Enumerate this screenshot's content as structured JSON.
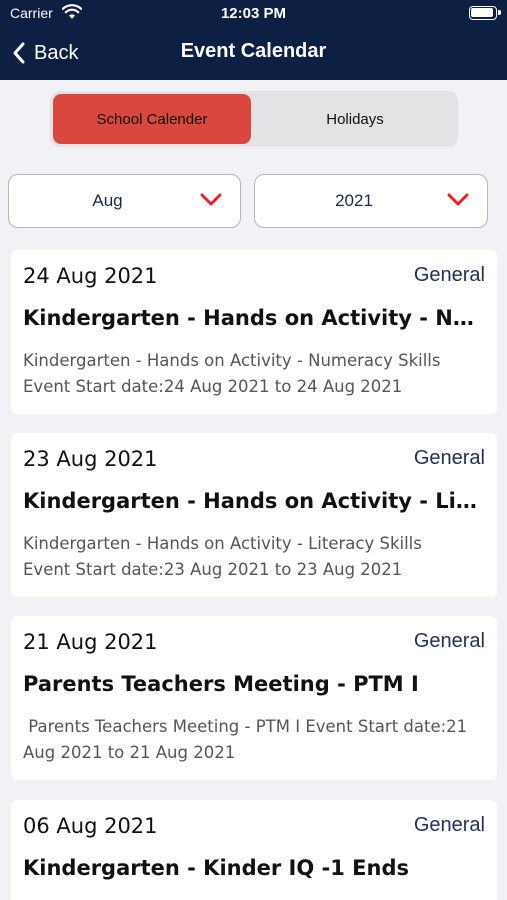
{
  "status_bar": {
    "carrier": "Carrier",
    "time": "12:03 PM"
  },
  "nav": {
    "back_label": "Back",
    "title": "Event Calendar"
  },
  "segments": {
    "active": "School Calender",
    "inactive": "Holidays"
  },
  "filters": {
    "month": "Aug",
    "year": "2021"
  },
  "colors": {
    "nav_bg": "#0e1f44",
    "accent": "#d9473e",
    "category": "#1f3156"
  },
  "events": [
    {
      "date": "24 Aug 2021",
      "category": "General",
      "title": "Kindergarten - Hands on Activity - Nume...",
      "description": "Kindergarten - Hands on Activity - Numeracy Skills\nEvent Start date:24 Aug 2021 to 24 Aug 2021"
    },
    {
      "date": "23 Aug 2021",
      "category": "General",
      "title": "Kindergarten - Hands on Activity - Litera...",
      "description": "Kindergarten - Hands on Activity - Literacy Skills\nEvent Start date:23 Aug 2021 to 23 Aug 2021"
    },
    {
      "date": "21 Aug 2021",
      "category": "General",
      "title": " Parents Teachers Meeting - PTM I",
      "description": " Parents Teachers Meeting - PTM I Event Start date:21\nAug 2021 to 21 Aug 2021"
    },
    {
      "date": "06 Aug 2021",
      "category": "General",
      "title": "Kindergarten - Kinder IQ -1 Ends",
      "description": ""
    }
  ]
}
